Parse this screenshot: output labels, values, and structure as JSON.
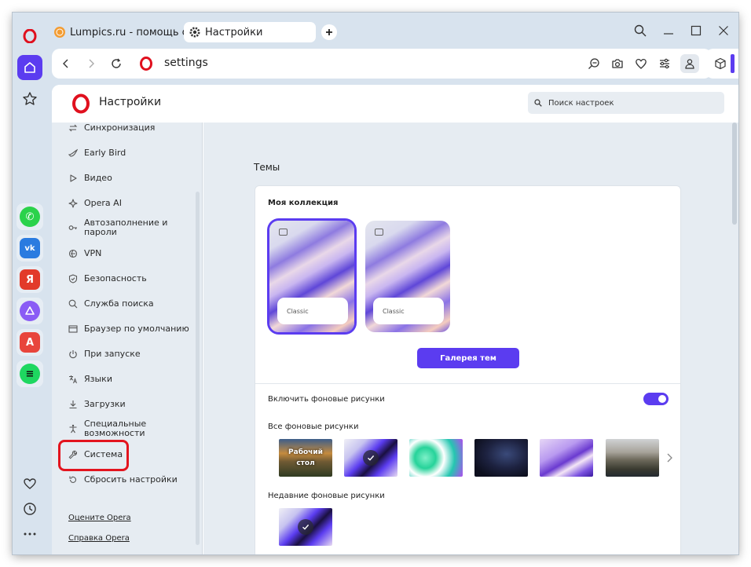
{
  "browser": {
    "tabs": [
      {
        "label": "Lumpics.ru - помощь с ко",
        "active": false
      },
      {
        "label": "Настройки",
        "active": true
      }
    ],
    "address": "settings",
    "accent_color": "#5b3cf0"
  },
  "rail": {
    "apps": [
      {
        "name": "whatsapp",
        "glyph": "✆",
        "color": "#2bd24b"
      },
      {
        "name": "vk",
        "glyph": "vk",
        "color": "#2a7be0"
      },
      {
        "name": "yandex",
        "glyph": "Я",
        "color": "#e23a2a"
      },
      {
        "name": "alice",
        "glyph": "",
        "color": "#8a5cf5"
      },
      {
        "name": "translate",
        "glyph": "A",
        "color": "#e8453c"
      },
      {
        "name": "spotify",
        "glyph": "≡",
        "color": "#1ed760"
      }
    ]
  },
  "settings": {
    "title": "Настройки",
    "search_placeholder": "Поиск настроек",
    "sidebar_items": [
      {
        "label": "Синхронизация",
        "icon": "sync-icon"
      },
      {
        "label": "Early Bird",
        "icon": "bird-icon"
      },
      {
        "label": "Видео",
        "icon": "play-icon"
      },
      {
        "label": "Opera AI",
        "icon": "sparkle-icon"
      },
      {
        "label": "Автозаполнение и пароли",
        "icon": "key-icon"
      },
      {
        "label": "VPN",
        "icon": "vpn-icon"
      },
      {
        "label": "Безопасность",
        "icon": "shield-icon"
      },
      {
        "label": "Служба поиска",
        "icon": "search-icon"
      },
      {
        "label": "Браузер по умолчанию",
        "icon": "browser-icon"
      },
      {
        "label": "При запуске",
        "icon": "power-icon"
      },
      {
        "label": "Языки",
        "icon": "language-icon"
      },
      {
        "label": "Загрузки",
        "icon": "download-icon"
      },
      {
        "label": "Специальные возможности",
        "icon": "accessibility-icon"
      },
      {
        "label": "Система",
        "icon": "wrench-icon"
      },
      {
        "label": "Сбросить настройки",
        "icon": "reset-icon"
      }
    ],
    "links": [
      "Оцените Opera",
      "Справка Opera"
    ]
  },
  "themes": {
    "section_title": "Темы",
    "collection_title": "Моя коллекция",
    "tiles": [
      {
        "label": "Classic",
        "selected": true
      },
      {
        "label": "Classic",
        "selected": false
      }
    ],
    "gallery_button": "Галерея тем",
    "toggle_label": "Включить фоновые рисунки",
    "toggle_on": true,
    "all_backgrounds_label": "Все фоновые рисунки",
    "desktop_wallpaper_label": "Рабочий стол",
    "recent_backgrounds_label": "Недавние фоновые рисунки"
  }
}
